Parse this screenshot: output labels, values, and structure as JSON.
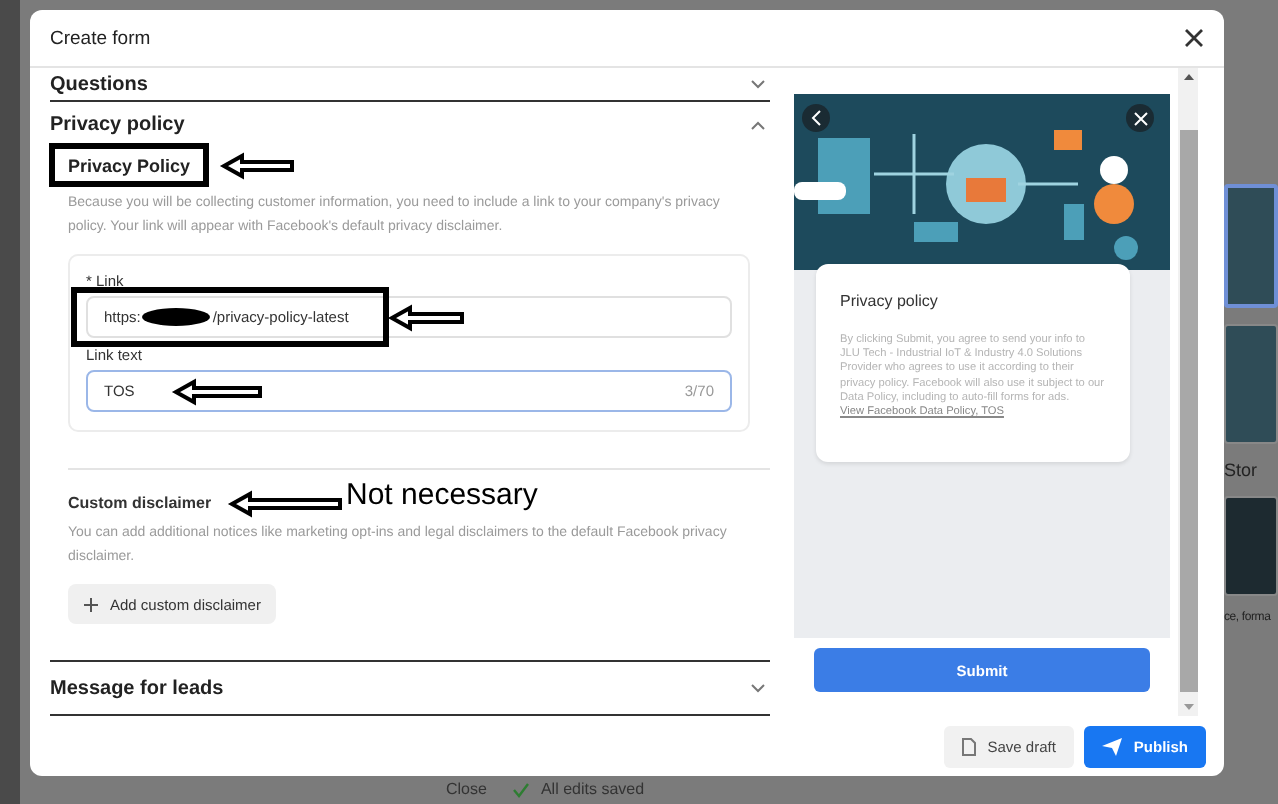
{
  "background": {
    "side_heading": "Stor",
    "side_text": "ce, forma",
    "close": "Close",
    "save_status": "All edits saved"
  },
  "dialog": {
    "title": "Create form",
    "sections": [
      {
        "title": "Questions",
        "expanded": false
      },
      {
        "title": "Privacy policy",
        "expanded": true
      },
      {
        "title": "Message for leads",
        "expanded": false
      }
    ],
    "privacy": {
      "heading": "Privacy Policy",
      "description": "Because you will be collecting customer information, you need to include a link to your company's privacy policy. Your link will appear with Facebook's default privacy disclaimer.",
      "link": {
        "label": "* Link",
        "value_start": "https:",
        "value_end": "/privacy-policy-latest"
      },
      "link_text": {
        "label": "Link text",
        "value": "TOS",
        "counter": "3/70",
        "focused": true
      }
    },
    "custom_disclaimer": {
      "heading": "Custom disclaimer",
      "description": "You can add additional notices like marketing opt-ins and legal disclaimers to the default Facebook privacy disclaimer.",
      "button": "Add custom disclaimer"
    },
    "preview": {
      "title": "Privacy policy",
      "text": "By clicking Submit, you agree to send your info to JLU Tech - Industrial IoT & Industry 4.0 Solutions Provider who agrees to use it according to their privacy policy. Facebook will also use it subject to our Data Policy, including to auto-fill forms for ads. ",
      "link": "View Facebook Data Policy, TOS",
      "submit": "Submit"
    },
    "footer_buttons": [
      {
        "label": "Save draft",
        "kind": "secondary"
      },
      {
        "label": "Publish",
        "kind": "primary"
      }
    ]
  },
  "annotation_note": "Not necessary"
}
